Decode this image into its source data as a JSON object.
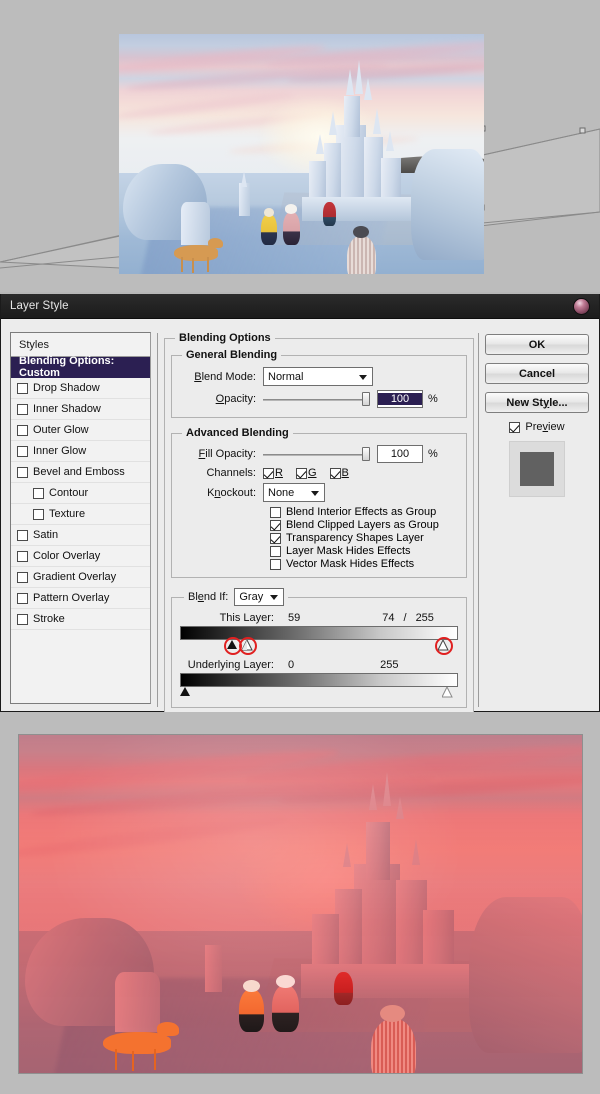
{
  "window": {
    "title": "Layer Style",
    "close_orb": "photoshop-orb"
  },
  "styles_panel": {
    "header": "Styles",
    "items": [
      {
        "label": "Blending Options: Custom",
        "selected": true,
        "checkbox": false,
        "indent": false
      },
      {
        "label": "Drop Shadow",
        "selected": false,
        "checkbox": true,
        "checked": false,
        "indent": false
      },
      {
        "label": "Inner Shadow",
        "selected": false,
        "checkbox": true,
        "checked": false,
        "indent": false
      },
      {
        "label": "Outer Glow",
        "selected": false,
        "checkbox": true,
        "checked": false,
        "indent": false
      },
      {
        "label": "Inner Glow",
        "selected": false,
        "checkbox": true,
        "checked": false,
        "indent": false
      },
      {
        "label": "Bevel and Emboss",
        "selected": false,
        "checkbox": true,
        "checked": false,
        "indent": false
      },
      {
        "label": "Contour",
        "selected": false,
        "checkbox": true,
        "checked": false,
        "indent": true
      },
      {
        "label": "Texture",
        "selected": false,
        "checkbox": true,
        "checked": false,
        "indent": true
      },
      {
        "label": "Satin",
        "selected": false,
        "checkbox": true,
        "checked": false,
        "indent": false
      },
      {
        "label": "Color Overlay",
        "selected": false,
        "checkbox": true,
        "checked": false,
        "indent": false
      },
      {
        "label": "Gradient Overlay",
        "selected": false,
        "checkbox": true,
        "checked": false,
        "indent": false
      },
      {
        "label": "Pattern Overlay",
        "selected": false,
        "checkbox": true,
        "checked": false,
        "indent": false
      },
      {
        "label": "Stroke",
        "selected": false,
        "checkbox": true,
        "checked": false,
        "indent": false
      }
    ]
  },
  "blending_options": {
    "legend": "Blending Options",
    "general": {
      "legend": "General Blending",
      "blend_mode_label": "Blend Mode:",
      "blend_mode_value": "Normal",
      "opacity_label": "Opacity:",
      "opacity_value": "100",
      "opacity_unit": "%",
      "opacity_percent": 100
    },
    "advanced": {
      "legend": "Advanced Blending",
      "fill_opacity_label": "Fill Opacity:",
      "fill_opacity_value": "100",
      "fill_opacity_unit": "%",
      "fill_opacity_percent": 100,
      "channels_label": "Channels:",
      "channels": [
        {
          "label": "R",
          "checked": true
        },
        {
          "label": "G",
          "checked": true
        },
        {
          "label": "B",
          "checked": true
        }
      ],
      "knockout_label": "Knockout:",
      "knockout_value": "None",
      "options": [
        {
          "label": "Blend Interior Effects as Group",
          "checked": false
        },
        {
          "label": "Blend Clipped Layers as Group",
          "checked": true
        },
        {
          "label": "Transparency Shapes Layer",
          "checked": true
        },
        {
          "label": "Layer Mask Hides Effects",
          "checked": false
        },
        {
          "label": "Vector Mask Hides Effects",
          "checked": false
        }
      ]
    },
    "blend_if": {
      "legend_label": "Blend If:",
      "channel_value": "Gray",
      "this_layer": {
        "label": "This Layer:",
        "black_value": "59",
        "split_value": "74",
        "separator": "/",
        "white_value": "255"
      },
      "underlying_layer": {
        "label": "Underlying Layer:",
        "black_value": "0",
        "white_value": "255"
      }
    }
  },
  "buttons": {
    "ok": "OK",
    "cancel": "Cancel",
    "new_style": "New Style...",
    "preview_label": "Preview",
    "preview_checked": true
  },
  "annotations": {
    "highlight_color": "#e02020",
    "circles": [
      {
        "name": "this-layer-black-shadow-stop"
      },
      {
        "name": "this-layer-black-highlight-stop"
      },
      {
        "name": "this-layer-white-stop"
      }
    ]
  },
  "canvas_top": {
    "name": "free-transform-sandcastle-layer",
    "description": "Sand castle winter scene with free-transform perspective handles"
  },
  "canvas_bottom": {
    "name": "red-tinted-result-preview",
    "description": "Same scene with heavy red/pink color overlay result"
  }
}
